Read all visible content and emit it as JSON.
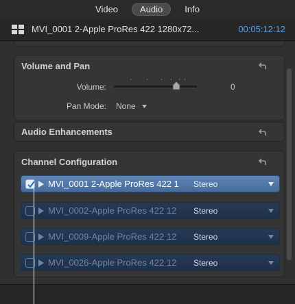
{
  "tabs": [
    {
      "label": "Video",
      "active": false
    },
    {
      "label": "Audio",
      "active": true
    },
    {
      "label": "Info",
      "active": false
    }
  ],
  "clip": {
    "icon": "clip-grid-icon",
    "title": "MVI_0001 2-Apple ProRes 422 1280x72...",
    "timecode": "00:05:12:12"
  },
  "volume_pan": {
    "title": "Volume and Pan",
    "volume_label": "Volume:",
    "volume_value": "0",
    "volume_level": 0.75,
    "pan_label": "Pan Mode:",
    "pan_value": "None"
  },
  "enhancements": {
    "title": "Audio Enhancements"
  },
  "channel_config": {
    "title": "Channel Configuration",
    "rows": [
      {
        "name": "MVI_0001 2-Apple ProRes 422 1",
        "type": "Stereo",
        "checked": true
      },
      {
        "name": "MVI_0002-Apple ProRes 422 12",
        "type": "Stereo",
        "checked": false
      },
      {
        "name": "MVI_0009-Apple ProRes 422 12",
        "type": "Stereo",
        "checked": false
      },
      {
        "name": "MVI_0026-Apple ProRes 422 12",
        "type": "Stereo",
        "checked": false
      }
    ]
  },
  "colors": {
    "accent": "#5aa0e6",
    "selected_row": "#5f86b6",
    "dim_row": "#273a55"
  }
}
